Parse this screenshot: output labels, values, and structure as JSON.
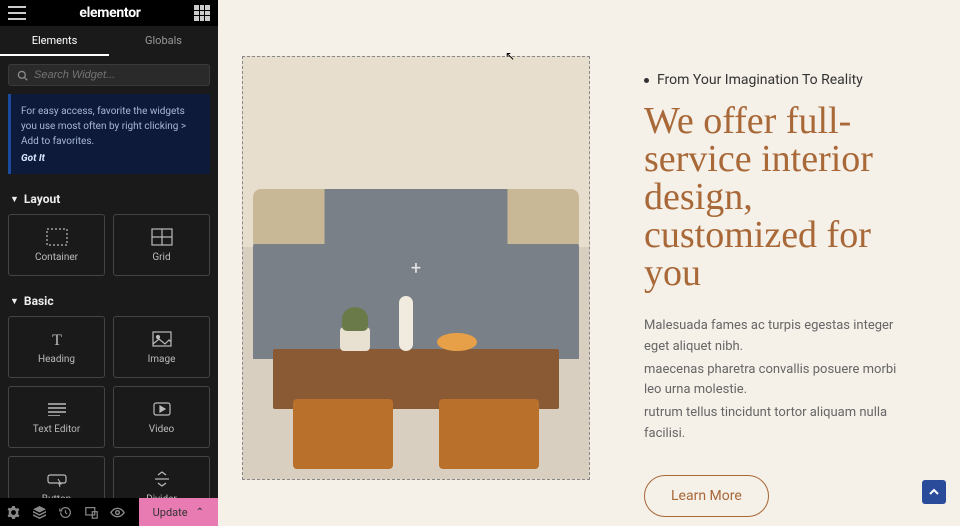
{
  "header": {
    "brand": "elementor"
  },
  "tabs": {
    "elements": "Elements",
    "globals": "Globals"
  },
  "search": {
    "placeholder": "Search Widget..."
  },
  "tip": {
    "text": "For easy access, favorite the widgets you use most often by right clicking > Add to favorites.",
    "got_it": "Got It"
  },
  "sections": {
    "layout": {
      "title": "Layout",
      "widgets": [
        "Container",
        "Grid"
      ]
    },
    "basic": {
      "title": "Basic",
      "widgets": [
        "Heading",
        "Image",
        "Text Editor",
        "Video",
        "Button",
        "Divider"
      ]
    }
  },
  "footer": {
    "update": "Update"
  },
  "canvas": {
    "eyebrow": "From Your Imagination To Reality",
    "headline": "We offer full-service interior design, customized for you",
    "body1": "Malesuada fames ac turpis egestas integer eget aliquet nibh.",
    "body2": "maecenas pharetra convallis posuere morbi leo urna molestie.",
    "body3": "rutrum tellus tincidunt tortor aliquam nulla facilisi.",
    "cta": "Learn More"
  },
  "colors": {
    "accent": "#a86838",
    "pink": "#e87bb1"
  }
}
